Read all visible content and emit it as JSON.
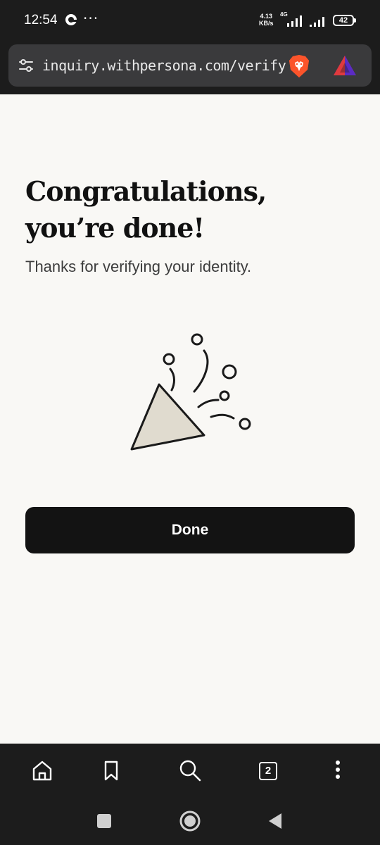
{
  "status_bar": {
    "time": "12:54",
    "dots": "···",
    "net_speed_value": "4.13",
    "net_speed_unit": "KB/s",
    "network_type": "4G",
    "battery": "42"
  },
  "browser": {
    "url": "inquiry.withpersona.com/verify",
    "tab_count": "2"
  },
  "content": {
    "title": "Congratulations, you’re done!",
    "subtitle": "Thanks for verifying your identity.",
    "done_label": "Done"
  },
  "icons": {
    "site_settings": "site-settings-icon",
    "brave": "brave-shield-icon",
    "rewards": "brave-rewards-icon",
    "home": "home-icon",
    "bookmark": "bookmark-icon",
    "search": "search-icon",
    "tabs": "tabs-icon",
    "menu": "more-vertical-icon",
    "nav_recent": "recent-apps-icon",
    "nav_home": "nav-home-icon",
    "nav_back": "back-icon",
    "illustration": "party-popper-icon"
  },
  "colors": {
    "page_background": "#f9f8f5",
    "button_background": "#131313",
    "chrome_background": "#1c1c1c",
    "url_bar_background": "#3a3a3c",
    "confetti_fill": "#e0dbcf"
  }
}
